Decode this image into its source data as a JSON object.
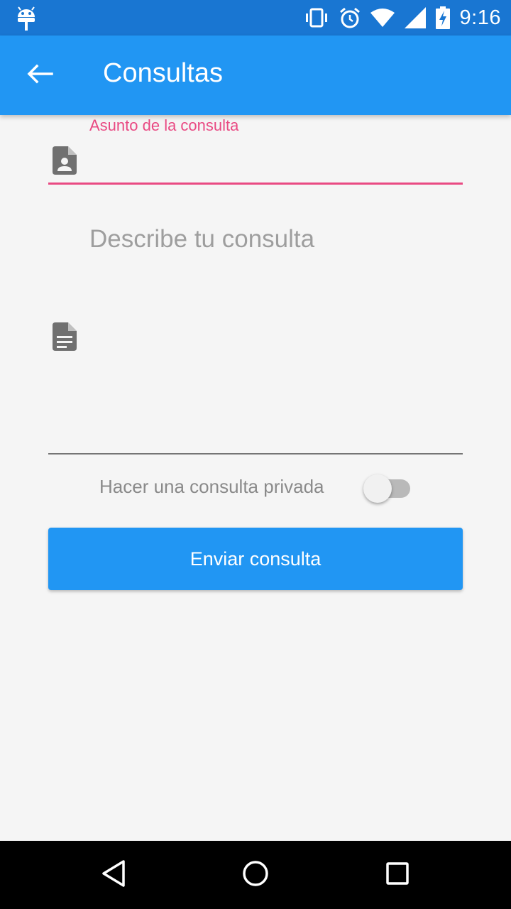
{
  "status_bar": {
    "time": "9:16",
    "icons": [
      "android-debug-icon",
      "vibrate-icon",
      "alarm-icon",
      "wifi-icon",
      "signal-icon",
      "battery-charging-icon"
    ]
  },
  "app_bar": {
    "title": "Consultas",
    "back_icon": "arrow-back-icon"
  },
  "form": {
    "subject": {
      "label": "Asunto de la consulta",
      "value": "",
      "icon": "contact-file-icon"
    },
    "description": {
      "placeholder": "Describe tu consulta",
      "icon": "document-text-icon"
    },
    "private_toggle": {
      "label": "Hacer una consulta privada",
      "checked": false
    },
    "submit_label": "Enviar consulta"
  },
  "nav_bar": {
    "buttons": [
      "back-triangle-icon",
      "home-circle-icon",
      "recents-square-icon"
    ]
  },
  "colors": {
    "status_bar": "#1976d2",
    "app_bar": "#2196f3",
    "accent": "#e94a83",
    "background": "#f5f5f5"
  }
}
